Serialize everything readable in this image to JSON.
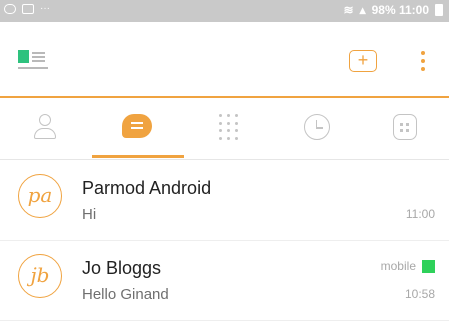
{
  "status_bar": {
    "right_text": "98% 11:00",
    "icons": [
      "notification-icon",
      "message-icon",
      "wifi-icon",
      "signal-icon",
      "battery-icon"
    ]
  },
  "app_bar": {
    "icons": [
      "menu-toggle-icon",
      "compose-icon",
      "more-vert-icon"
    ],
    "accent_color": "#f0a340",
    "brand_color": "#2ec27e"
  },
  "tabs": [
    {
      "name": "contacts",
      "icon": "contact-icon",
      "active": false
    },
    {
      "name": "chats",
      "icon": "chat-icon",
      "active": true
    },
    {
      "name": "dialpad",
      "icon": "dialpad-icon",
      "active": false
    },
    {
      "name": "history",
      "icon": "history-icon",
      "active": false
    },
    {
      "name": "voicemail",
      "icon": "voicemail-icon",
      "active": false
    }
  ],
  "conversations": [
    {
      "initials": "pa",
      "name": "Parmod Android",
      "message": "Hi",
      "time": "11:00"
    },
    {
      "initials": "jb",
      "name": "Jo Bloggs",
      "message": "Hello Ginand",
      "time": "10:58",
      "tag": "mobile",
      "presence_color": "#2ed15a"
    }
  ]
}
